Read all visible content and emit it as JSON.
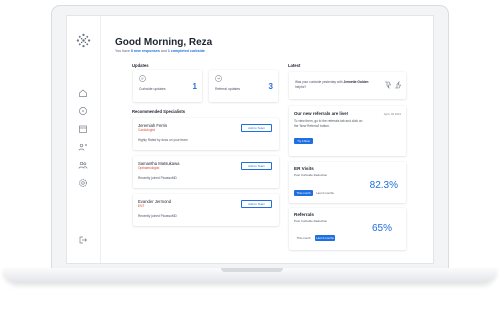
{
  "header": {
    "greeting": "Good Morning, Reza",
    "sub_prefix": "You have",
    "sub_link_1": "5 new responses",
    "sub_mid": "and",
    "sub_link_2": "1 completed curbside"
  },
  "updates": {
    "title": "Updates",
    "items": [
      {
        "label": "Curbside updates",
        "count": "1",
        "icon": "chat-bubble-icon"
      },
      {
        "label": "Referral updates",
        "count": "3",
        "icon": "referral-icon"
      }
    ]
  },
  "specialists": {
    "title": "Recommended Specialists",
    "button_label": "Add to Team",
    "items": [
      {
        "name": "Jeremiah Ferris",
        "role": "Cardiologist",
        "note": "Highly Rated by docs on your team"
      },
      {
        "name": "Samantha Matsukawa",
        "role": "Opthalmologist",
        "note": "Recently joined PicassoMD"
      },
      {
        "name": "Evander Jermond",
        "role": "ENT",
        "note": "Recently joined PicassoMD"
      }
    ]
  },
  "latest": {
    "title": "Latest",
    "feedback": {
      "question": "Was your curbside yesterday with",
      "bold": "Jennette Golden",
      "tail": "helpful?"
    },
    "news": {
      "title": "Our new referrals are live!",
      "date": "April, 30 2021",
      "body": "To view them, go to the referrals tab and click on the 'New Referral' button.",
      "button": "Try it Now"
    },
    "er": {
      "title": "ER Visits",
      "subtitle": "Post Curbside Reduction",
      "tabs": [
        "This month",
        "Last 3 months"
      ],
      "value": "82.3%"
    },
    "referrals": {
      "title": "Referrals",
      "subtitle": "Post Curbside Reduction",
      "tabs": [
        "This month",
        "Last 3 months"
      ],
      "value": "65%"
    }
  },
  "colors": {
    "accent": "#1f6fe0",
    "role": "#e04a3a"
  },
  "nav_icons": [
    "home-icon",
    "compass-icon",
    "calendar-icon",
    "team-icon",
    "people-icon",
    "settings-icon",
    "logout-icon"
  ]
}
